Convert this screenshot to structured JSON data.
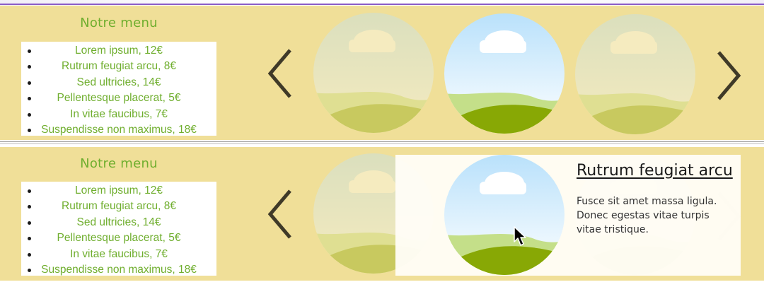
{
  "menus": [
    {
      "title": "Notre menu",
      "items": [
        "Lorem ipsum,  12€",
        "Rutrum feugiat arcu,  8€",
        "Sed ultricies, 14€",
        "Pellentesque placerat, 5€",
        "In vitae faucibus, 7€",
        "Suspendisse non maximus, 18€"
      ]
    },
    {
      "title": "Notre menu",
      "items": [
        "Lorem ipsum,  12€",
        "Rutrum feugiat arcu,  8€",
        "Sed ultricies, 14€",
        "Pellentesque placerat, 5€",
        "In vitae faucibus, 7€",
        "Suspendisse non maximus, 18€"
      ]
    }
  ],
  "detail": {
    "title": "Rutrum feugiat arcu",
    "text": "Fusce sit amet massa ligula. Donec egestas vitae turpis vitae tristique."
  },
  "icons": {
    "prev": "chevron-left-icon",
    "next": "chevron-right-icon",
    "image": "landscape-icon",
    "cursor": "mouse-pointer-icon"
  },
  "colors": {
    "panel_background": "#f0df98",
    "menu_text": "#6fae2e",
    "arrow": "#3f3a28",
    "top_rule": "#8a5cc8"
  }
}
